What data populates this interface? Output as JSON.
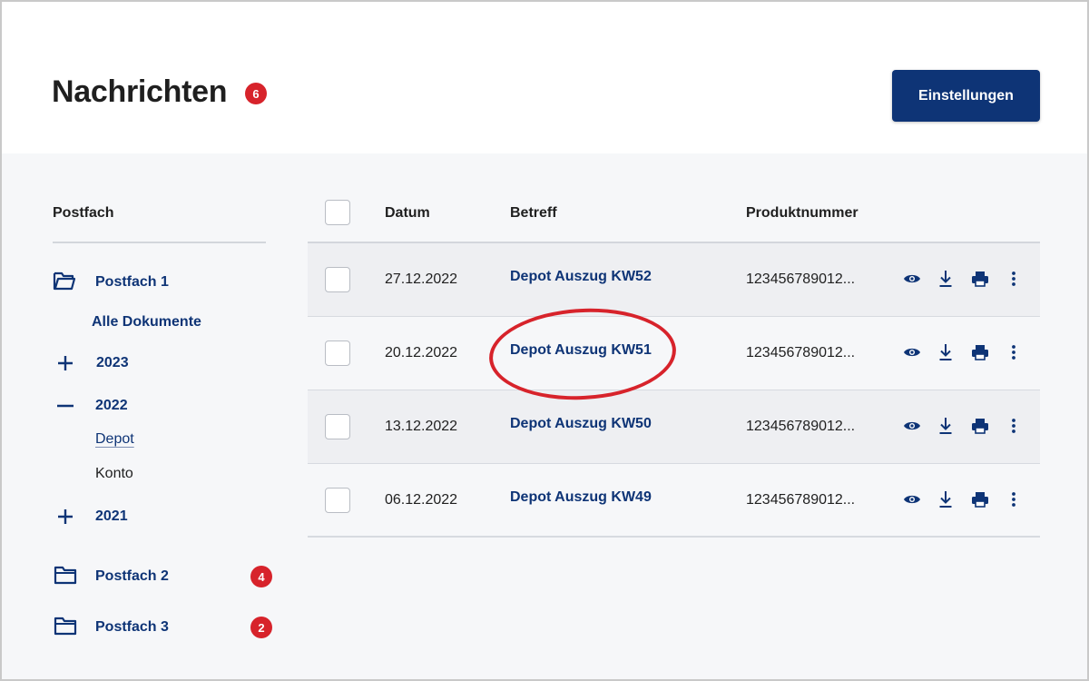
{
  "header": {
    "title": "Nachrichten",
    "unread_count": "6",
    "settings_label": "Einstellungen"
  },
  "sidebar": {
    "heading": "Postfach",
    "items": [
      {
        "label": "Postfach 1",
        "icon": "folder-open-icon"
      },
      {
        "label": "Alle Dokumente"
      },
      {
        "label": "2023",
        "icon": "plus-icon"
      },
      {
        "label": "2022",
        "icon": "minus-icon"
      },
      {
        "label": "Depot"
      },
      {
        "label": "Konto"
      },
      {
        "label": "2021",
        "icon": "plus-icon"
      },
      {
        "label": "Postfach 2",
        "icon": "folder-icon",
        "badge": "4"
      },
      {
        "label": "Postfach 3",
        "icon": "folder-icon",
        "badge": "2"
      }
    ]
  },
  "table": {
    "columns": [
      "Datum",
      "Betreff",
      "Produktnummer"
    ],
    "rows": [
      {
        "date": "27.12.2022",
        "subject": "Depot Auszug KW52",
        "product": "123456789012..."
      },
      {
        "date": "20.12.2022",
        "subject": "Depot Auszug KW51",
        "product": "123456789012..."
      },
      {
        "date": "13.12.2022",
        "subject": "Depot Auszug KW50",
        "product": "123456789012..."
      },
      {
        "date": "06.12.2022",
        "subject": "Depot Auszug KW49",
        "product": "123456789012..."
      }
    ],
    "actions": [
      "eye-icon",
      "download-icon",
      "printer-icon",
      "more-vertical-icon"
    ]
  },
  "colors": {
    "brand": "#0e3476",
    "badge": "#d7232b",
    "highlight": "#d7232b"
  }
}
